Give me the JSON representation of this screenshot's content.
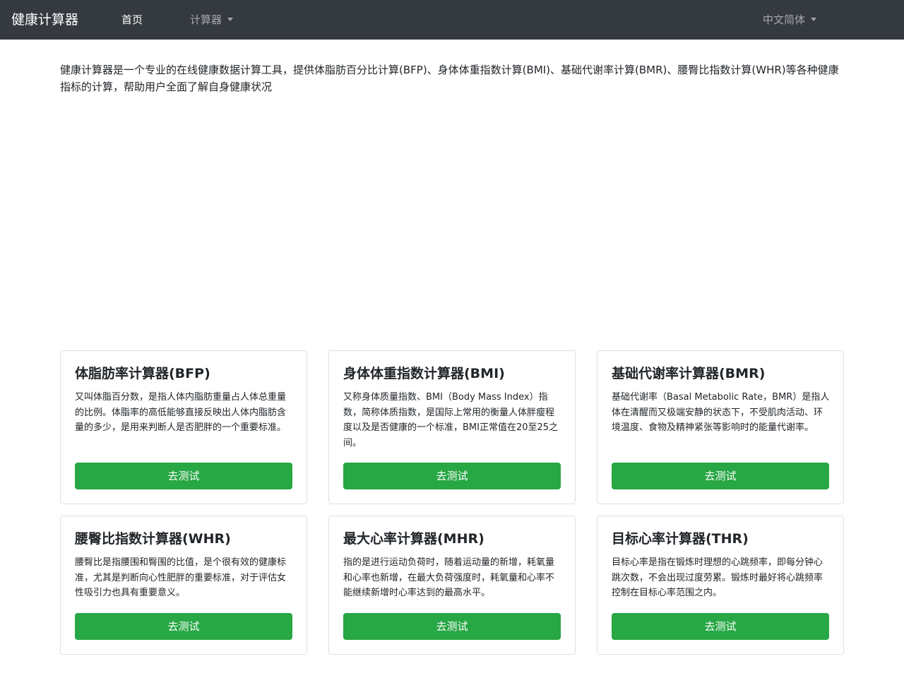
{
  "navbar": {
    "brand": "健康计算器",
    "home": "首页",
    "calculators": "计算器",
    "language": "中文简体"
  },
  "intro": "健康计算器是一个专业的在线健康数据计算工具，提供体脂肪百分比计算(BFP)、身体体重指数计算(BMI)、基础代谢率计算(BMR)、腰臀比指数计算(WHR)等各种健康指标的计算，帮助用户全面了解自身健康状况",
  "cards": [
    {
      "title": "体脂肪率计算器(BFP)",
      "text": "又叫体脂百分数，是指人体内脂肪重量占人体总重量的比例。体脂率的高低能够直接反映出人体内脂肪含量的多少，是用来判断人是否肥胖的一个重要标准。",
      "button": "去测试"
    },
    {
      "title": "身体体重指数计算器(BMI)",
      "text": "又称身体质量指数、BMI（Body Mass Index）指数，简称体质指数，是国际上常用的衡量人体胖瘦程度以及是否健康的一个标准，BMI正常值在20至25之间。",
      "button": "去测试"
    },
    {
      "title": "基础代谢率计算器(BMR)",
      "text": "基础代谢率（Basal Metabolic Rate，BMR）是指人体在清醒而又极端安静的状态下，不受肌肉活动、环境温度、食物及精神紧张等影响时的能量代谢率。",
      "button": "去测试"
    },
    {
      "title": "腰臀比指数计算器(WHR)",
      "text": "腰臀比是指腰围和臀围的比值，是个很有效的健康标准，尤其是判断向心性肥胖的重要标准，对于评估女性吸引力也具有重要意义。",
      "button": "去测试"
    },
    {
      "title": "最大心率计算器(MHR)",
      "text": "指的是进行运动负荷时，随着运动量的新增，耗氧量和心率也新增，在最大负荷强度时，耗氧量和心率不能继续新增时心率达到的最高水平。",
      "button": "去测试"
    },
    {
      "title": "目标心率计算器(THR)",
      "text": "目标心率是指在锻炼时理想的心跳频率，即每分钟心跳次数，不会出现过度劳累。锻炼时最好将心跳频率控制在目标心率范围之内。",
      "button": "去测试"
    }
  ]
}
